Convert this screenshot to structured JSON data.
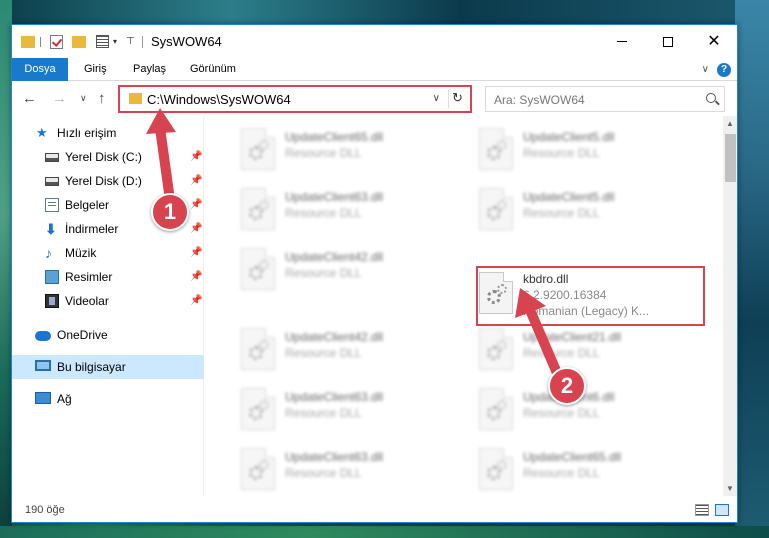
{
  "window": {
    "title": "SysWOW64"
  },
  "ribbon": {
    "tabs": [
      "Dosya",
      "Giriş",
      "Paylaş",
      "Görünüm"
    ],
    "help_label": "?"
  },
  "nav": {
    "address": "C:\\Windows\\SysWOW64",
    "search_placeholder": "Ara: SysWOW64"
  },
  "sidebar": {
    "items": [
      {
        "label": "Hızlı erişim"
      },
      {
        "label": "Yerel Disk (C:)"
      },
      {
        "label": "Yerel Disk (D:)"
      },
      {
        "label": "Belgeler"
      },
      {
        "label": "İndirmeler"
      },
      {
        "label": "Müzik"
      },
      {
        "label": "Resimler"
      },
      {
        "label": "Videolar"
      },
      {
        "label": "OneDrive"
      },
      {
        "label": "Bu bilgisayar"
      },
      {
        "label": "Ağ"
      }
    ]
  },
  "files": [
    {
      "name": "UpdateClient65.dll",
      "desc": "Resource DLL"
    },
    {
      "name": "UpdateClient5.dll",
      "desc": "Resource DLL"
    },
    {
      "name": "UpdateClient63.dll",
      "desc": "Resource DLL"
    },
    {
      "name": "UpdateClient5.dll",
      "desc": "Resource DLL"
    },
    {
      "name": "UpdateClient42.dll",
      "desc": "Resource DLL"
    },
    {
      "name": "kbdro.dll",
      "desc": "6.2.9200.16384",
      "desc2": "Romanian (Legacy) K..."
    },
    {
      "name": "UpdateClient42.dll",
      "desc": "Resource DLL"
    },
    {
      "name": "UpdateClient21.dll",
      "desc": "Resource DLL"
    },
    {
      "name": "UpdateClient63.dll",
      "desc": "Resource DLL"
    },
    {
      "name": "UpdateClient6.dll",
      "desc": "Resource DLL"
    },
    {
      "name": "UpdateClient63.dll",
      "desc": "Resource DLL"
    },
    {
      "name": "UpdateClient65.dll",
      "desc": "Resource DLL"
    }
  ],
  "status": {
    "item_count": "190 öğe"
  },
  "annotations": {
    "step1": "1",
    "step2": "2",
    "accent_color": "#d7434f"
  }
}
